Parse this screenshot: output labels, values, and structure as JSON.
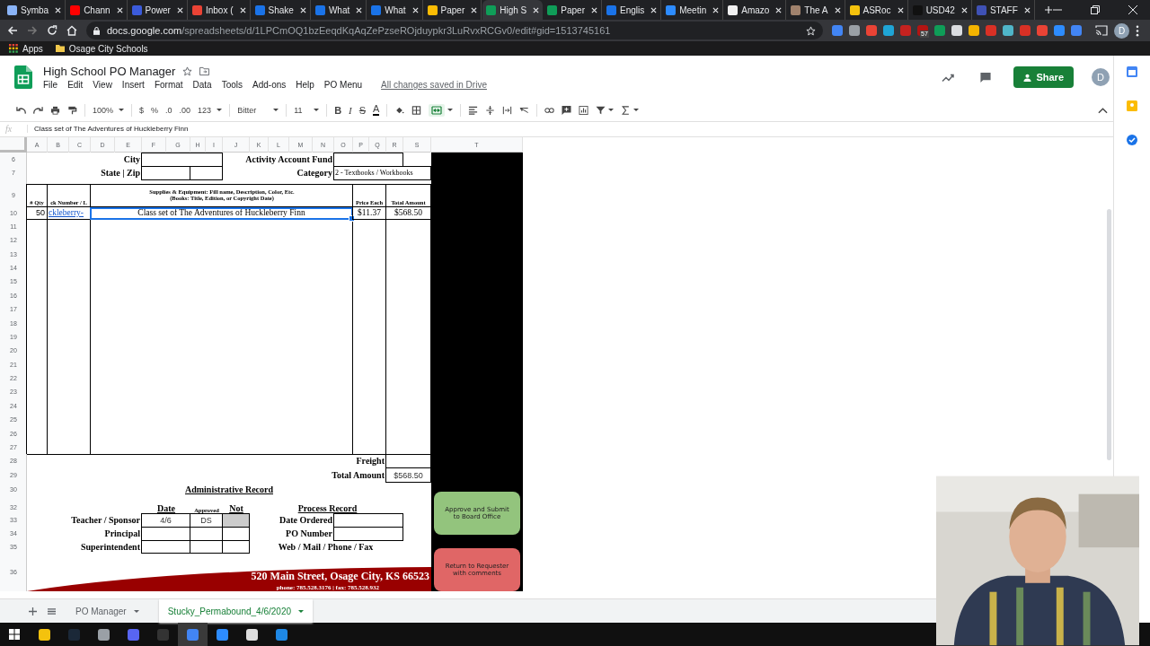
{
  "browser": {
    "tabs": [
      {
        "title": "Symba",
        "color": "#8ab4f8",
        "selected": false
      },
      {
        "title": "Chann",
        "color": "#ff0000",
        "selected": false
      },
      {
        "title": "Power",
        "color": "#3b5bdb",
        "selected": false
      },
      {
        "title": "Inbox (",
        "color": "#ea4335",
        "selected": false
      },
      {
        "title": "Shake",
        "color": "#1a73e8",
        "selected": false
      },
      {
        "title": "What",
        "color": "#1a73e8",
        "selected": false
      },
      {
        "title": "What",
        "color": "#1a73e8",
        "selected": false
      },
      {
        "title": "Paper",
        "color": "#fbbc04",
        "selected": false
      },
      {
        "title": "High S",
        "color": "#0f9d58",
        "selected": true
      },
      {
        "title": "Paper",
        "color": "#0f9d58",
        "selected": false
      },
      {
        "title": "Englis",
        "color": "#1a73e8",
        "selected": false
      },
      {
        "title": "Meetin",
        "color": "#2d8cff",
        "selected": false
      },
      {
        "title": "Amazo",
        "color": "#f1f1f1",
        "selected": false
      },
      {
        "title": "The A",
        "color": "#a0826d",
        "selected": false
      },
      {
        "title": "ASRoc",
        "color": "#f4c20d",
        "selected": false
      },
      {
        "title": "USD42",
        "color": "#111111",
        "selected": false
      },
      {
        "title": "STAFF",
        "color": "#3f51b5",
        "selected": false
      }
    ],
    "url_host": "docs.google.com",
    "url_path": "/spreadsheets/d/1LPCmOQ1bzEeqdKqAqZePzseROjduypkr3LuRvxRCGv0/edit#gid=1513745161",
    "extension_badge": "57",
    "avatar": "D",
    "bookmarks": [
      "Apps",
      "Osage City Schools"
    ]
  },
  "sheets": {
    "title": "High School PO Manager",
    "menu": [
      "File",
      "Edit",
      "View",
      "Insert",
      "Format",
      "Data",
      "Tools",
      "Add-ons",
      "Help",
      "PO Menu"
    ],
    "save_status": "All changes saved in Drive",
    "share": "Share",
    "avatar": "D",
    "toolbar": {
      "zoom": "100%",
      "currency": "$",
      "percent": "%",
      "decrease_decimals": ".0",
      "increase_decimals": ".00",
      "more_formats": "123",
      "font": "Bitter",
      "font_size": "11",
      "bold": "B",
      "italic": "I",
      "strikethrough": "S",
      "text_color": "A",
      "merge_active": true
    },
    "formula_label": "fx",
    "formula": "Class set of The Adventures of Huckleberry Finn",
    "columns": [
      "A",
      "B",
      "C",
      "D",
      "E",
      "F",
      "G",
      "H",
      "I",
      "J",
      "K",
      "L",
      "M",
      "N",
      "O",
      "P",
      "Q",
      "R",
      "S",
      "T"
    ],
    "rows": [
      "6",
      "7",
      "9",
      "10",
      "11",
      "12",
      "13",
      "14",
      "15",
      "16",
      "17",
      "18",
      "19",
      "20",
      "21",
      "22",
      "23",
      "24",
      "25",
      "26",
      "27",
      "28",
      "29",
      "30",
      "32",
      "33",
      "34",
      "35",
      "36"
    ],
    "form": {
      "city_label": "City",
      "state_zip_label": "State | Zip",
      "fund_label": "Activity Account Fund",
      "category_label": "Category",
      "category": "2 - Textbooks / Workbooks",
      "item_headers": {
        "qty": "# Qty",
        "number": "ck Number / L",
        "description_line1": "Supplies & Equipment:  Fill name, Description, Color, Etc.",
        "description_line2": "(Books:  Title, Edition, or Copyright Date)",
        "price": "Price Each",
        "total": "Total Amount"
      },
      "items": [
        {
          "qty": "50",
          "number": "ckleberry-",
          "description": "Class set of The Adventures of Huckleberry Finn",
          "price": "$11.37",
          "total": "$568.50",
          "description_selected": true
        }
      ],
      "freight_label": "Freight",
      "total_label": "Total Amount",
      "total": "$568.50",
      "admin_title": "Administrative Record",
      "date_header": "Date",
      "approved_header": "Approved",
      "not_header": "Not",
      "signers": [
        {
          "role": "Teacher / Sponsor",
          "date": "4/6",
          "approved": "DS",
          "not_shaded": true
        },
        {
          "role": "Principal",
          "not_shaded": false
        },
        {
          "role": "Superintendent",
          "not_shaded": false
        }
      ],
      "process_title": "Process Record",
      "process_fields": [
        {
          "label": "Date Ordered",
          "kind": "box"
        },
        {
          "label": "PO Number",
          "kind": "box"
        },
        {
          "label": "Web / Mail / Phone / Fax",
          "kind": "plain"
        }
      ],
      "footer_address": "520 Main Street, Osage City, KS 66523",
      "footer_contact": "phone: 785.528.3176 | fax: 785.528.932",
      "actions": [
        {
          "label": "Approve and Submit to Board Office",
          "color": "#93c47d"
        },
        {
          "label": "Return to Requester with comments",
          "color": "#e06666"
        }
      ]
    },
    "sheet_tabs": [
      {
        "label": "PO Manager",
        "selected": false
      },
      {
        "label": "Stucky_Permabound_4/6/2020",
        "selected": true
      }
    ]
  }
}
